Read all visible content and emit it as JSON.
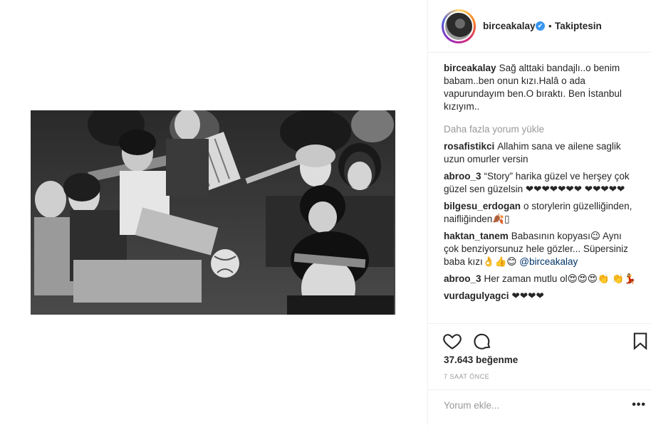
{
  "post": {
    "author": {
      "username": "birceakalay",
      "verified_mark": "✔",
      "separator": "•",
      "follow_status": "Takiptesin"
    },
    "caption": {
      "username": "birceakalay",
      "text": "Sağ alttaki bandajlı..o benim babam..ben onun kızı.Halâ o ada vapurundayım ben.O bıraktı. Ben İstanbul kızıyım.."
    },
    "load_more": "Daha fazla yorum yükle",
    "comments": [
      {
        "username": "rosafistikci",
        "text": "Allahim sana ve ailene saglik uzun omurler versin"
      },
      {
        "username": "abroo_3",
        "text": "“Story” harika güzel ve herşey çok güzel sen güzelsin ❤❤❤❤❤❤❤ ❤❤❤❤❤"
      },
      {
        "username": "bilgesu_erdogan",
        "text": "o storylerin güzelliğinden, naifliğinden🍂▯"
      },
      {
        "username": "haktan_tanem",
        "text": "Babasının kopyası😉 Aynı çok benziyorsunuz hele gözler... Süpersiniz baba kızı👌👍😊 ",
        "mention": "@birceakalay"
      },
      {
        "username": "abroo_3",
        "text": "Her zaman mutlu ol😍😍😍👏 👏💃"
      },
      {
        "username": "vurdagulyagci",
        "text": "❤❤❤❤"
      }
    ],
    "likes": "37.643 beğenme",
    "timestamp": "7 SAAT ÖNCE",
    "comment_placeholder": "Yorum ekle...",
    "more_options": "•••",
    "icons": {
      "like": "heart-icon",
      "comment": "comment-bubble-icon",
      "save": "bookmark-icon"
    },
    "colors": {
      "verified": "#3897f0",
      "muted": "#999999",
      "text": "#262626",
      "border": "#efefef"
    }
  }
}
